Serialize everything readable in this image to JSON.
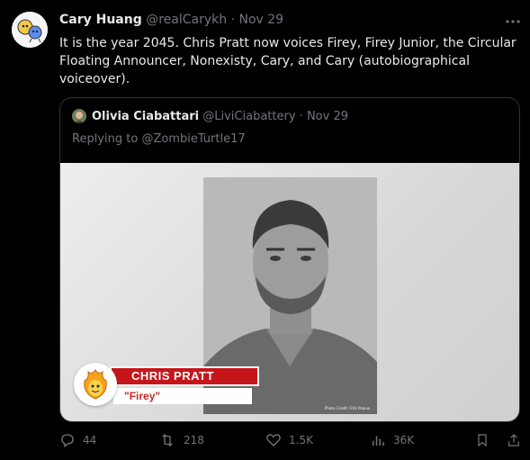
{
  "tweet": {
    "author_name": "Cary Huang",
    "handle": "@realCarykh",
    "separator": "·",
    "date": "Nov 29",
    "text": "It is the year 2045. Chris Pratt now voices Firey, Firey Junior, the Circular Floating Announcer, Nonexisty, Cary, and Cary (autobiographical voiceover)."
  },
  "quote": {
    "author_name": "Olivia Ciabattari",
    "handle": "@LiviCiabattery",
    "separator": "·",
    "date": "Nov 29",
    "replying_prefix": "Replying to ",
    "replying_handle": "@ZombieTurtle17",
    "media": {
      "name_card": "CHRIS PRATT",
      "role_card": "\"Firey\"",
      "photo_credit": "Photo Credit: Fritz Paauw"
    }
  },
  "actions": {
    "replies": "44",
    "retweets": "218",
    "likes": "1.5K",
    "views": "36K"
  },
  "icons": {
    "more": "more-options-icon",
    "reply": "reply-icon",
    "retweet": "retweet-icon",
    "like": "heart-icon",
    "views": "views-icon",
    "bookmark": "bookmark-icon",
    "share": "share-icon"
  },
  "colors": {
    "background": "#000000",
    "text": "#e7e9ea",
    "muted": "#71767b",
    "border": "#2f3336",
    "banner_red": "#c6161c"
  }
}
